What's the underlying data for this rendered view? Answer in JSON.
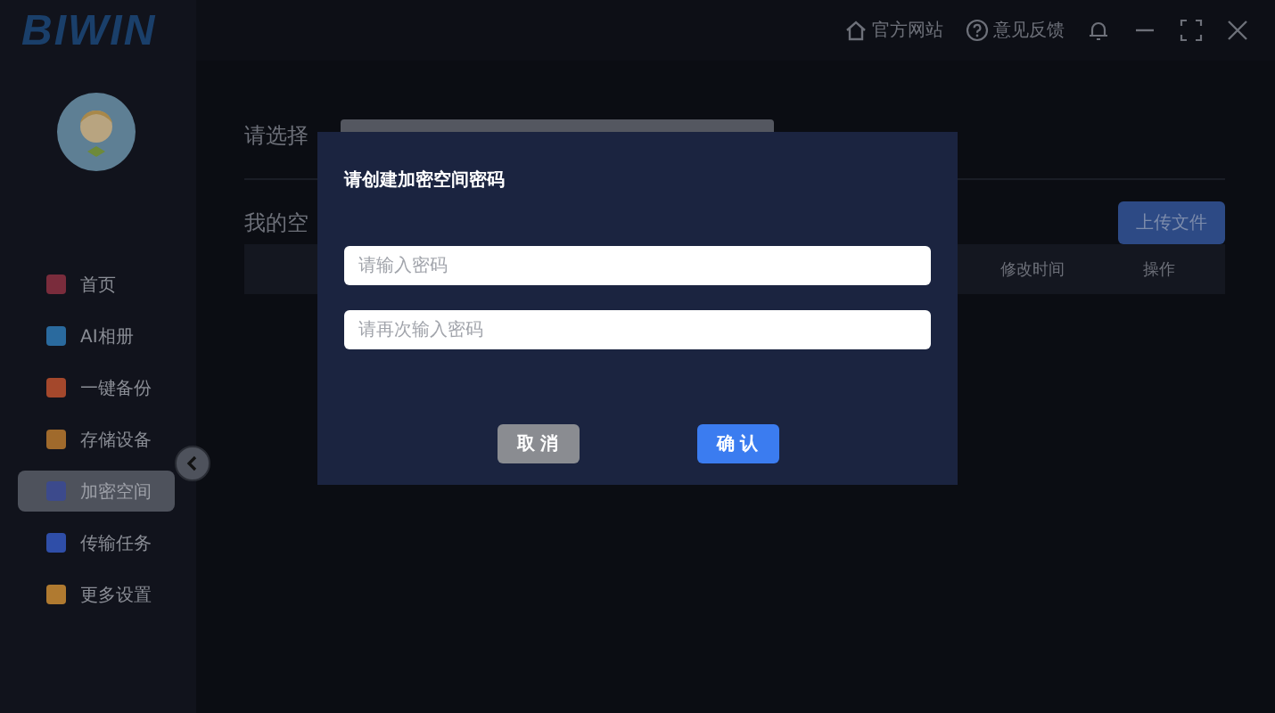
{
  "logo": "BIWIN",
  "title_bar": {
    "links": [
      {
        "kind": "home",
        "label": "官方网站"
      },
      {
        "kind": "help",
        "label": "意见反馈"
      }
    ]
  },
  "sidebar": {
    "items": [
      {
        "label": "首页",
        "color": "#7a2c3c",
        "selected": false
      },
      {
        "label": "AI相册",
        "color": "#2a6a9e",
        "selected": false
      },
      {
        "label": "一键备份",
        "color": "#a4482c",
        "selected": false
      },
      {
        "label": "存储设备",
        "color": "#a06a2c",
        "selected": false
      },
      {
        "label": "加密空间",
        "color": "#3c4a8c",
        "selected": true
      },
      {
        "label": "传输任务",
        "color": "#2f4ea8",
        "selected": false
      },
      {
        "label": "更多设置",
        "color": "#b07a30",
        "selected": false
      }
    ]
  },
  "main": {
    "path_label": "请选择",
    "space_label": "我的空",
    "upload_button": "上传文件",
    "table": {
      "columns": [
        "修改时间",
        "操作"
      ]
    }
  },
  "dialog": {
    "title": "请创建加密空间密码",
    "fields": [
      {
        "placeholder": "请输入密码"
      },
      {
        "placeholder": "请再次输入密码"
      }
    ],
    "cancel": "取 消",
    "confirm": "确 认"
  }
}
